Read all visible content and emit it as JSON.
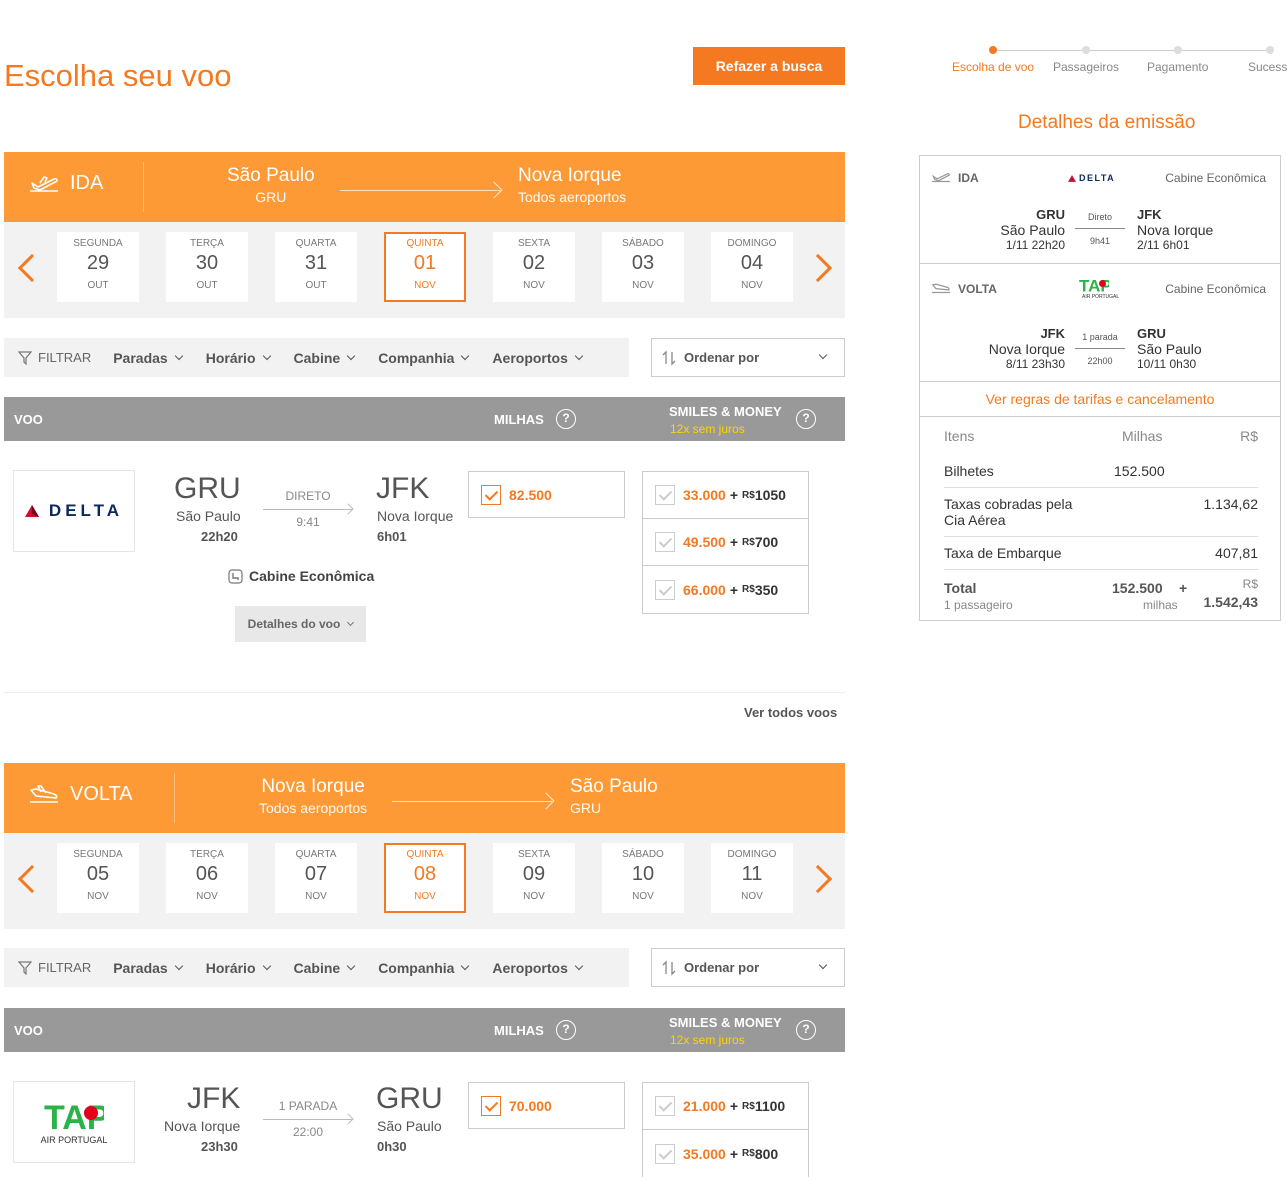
{
  "page_title": "Escolha seu voo",
  "redo_search_label": "Refazer a busca",
  "stepper": [
    "Escolha de voo",
    "Passageiros",
    "Pagamento",
    "Sucess"
  ],
  "sections": [
    {
      "direction": "IDA",
      "from_city": "São Paulo",
      "from_sub": "GRU",
      "to_city": "Nova Iorque",
      "to_sub": "Todos aeroportos",
      "dates": [
        {
          "weekday": "SEGUNDA",
          "day": "29",
          "month": "OUT"
        },
        {
          "weekday": "TERÇA",
          "day": "30",
          "month": "OUT"
        },
        {
          "weekday": "QUARTA",
          "day": "31",
          "month": "OUT"
        },
        {
          "weekday": "QUINTA",
          "day": "01",
          "month": "NOV",
          "selected": true
        },
        {
          "weekday": "SEXTA",
          "day": "02",
          "month": "NOV"
        },
        {
          "weekday": "SÁBADO",
          "day": "03",
          "month": "NOV"
        },
        {
          "weekday": "DOMINGO",
          "day": "04",
          "month": "NOV"
        }
      ],
      "flight": {
        "airline": "DELTA",
        "origin": "GRU",
        "origin_city": "São Paulo",
        "origin_time": "22h20",
        "stops": "DIRETO",
        "duration": "9:41",
        "dest": "JFK",
        "dest_city": "Nova Iorque",
        "dest_time": "6h01",
        "miles": "82.500",
        "smiles_money": [
          {
            "miles": "33.000",
            "money": "1050"
          },
          {
            "miles": "49.500",
            "money": "700"
          },
          {
            "miles": "66.000",
            "money": "350"
          }
        ]
      }
    },
    {
      "direction": "VOLTA",
      "from_city": "Nova Iorque",
      "from_sub": "Todos aeroportos",
      "to_city": "São Paulo",
      "to_sub": "GRU",
      "dates": [
        {
          "weekday": "SEGUNDA",
          "day": "05",
          "month": "NOV"
        },
        {
          "weekday": "TERÇA",
          "day": "06",
          "month": "NOV"
        },
        {
          "weekday": "QUARTA",
          "day": "07",
          "month": "NOV"
        },
        {
          "weekday": "QUINTA",
          "day": "08",
          "month": "NOV",
          "selected": true
        },
        {
          "weekday": "SEXTA",
          "day": "09",
          "month": "NOV"
        },
        {
          "weekday": "SÁBADO",
          "day": "10",
          "month": "NOV"
        },
        {
          "weekday": "DOMINGO",
          "day": "11",
          "month": "NOV"
        }
      ],
      "flight": {
        "airline": "TAP",
        "airline_sub": "AIR PORTUGAL",
        "origin": "JFK",
        "origin_city": "Nova Iorque",
        "origin_time": "23h30",
        "stops": "1 PARADA",
        "duration": "22:00",
        "dest": "GRU",
        "dest_city": "São Paulo",
        "dest_time": "0h30",
        "miles": "70.000",
        "smiles_money": [
          {
            "miles": "21.000",
            "money": "1100"
          },
          {
            "miles": "35.000",
            "money": "800"
          }
        ]
      }
    }
  ],
  "filter": {
    "label": "FILTRAR",
    "options": [
      "Paradas",
      "Horário",
      "Cabine",
      "Companhia",
      "Aeroportos"
    ],
    "sort_label": "Ordenar por"
  },
  "table_header": {
    "voo": "VOO",
    "milhas": "MILHAS",
    "smiles_money": "SMILES & MONEY",
    "installments": "12x sem juros",
    "help": "?"
  },
  "cabin_label": "Cabine Econômica",
  "details_button": "Detalhes do voo",
  "see_all": "Ver todos voos",
  "currency_symbol": "R$",
  "plus": "+",
  "panel": {
    "title": "Detalhes da emissão",
    "ida": {
      "label": "IDA",
      "airline": "DELTA",
      "cabin": "Cabine Econômica",
      "from": "GRU",
      "from_city": "São Paulo",
      "from_dt": "1/11 22h20",
      "stops": "Direto",
      "duration": "9h41",
      "to": "JFK",
      "to_city": "Nova Iorque",
      "to_dt": "2/11 6h01"
    },
    "volta": {
      "label": "VOLTA",
      "airline": "TAP",
      "airline_sub": "AIR PORTUGAL",
      "cabin": "Cabine Econômica",
      "from": "JFK",
      "from_city": "Nova Iorque",
      "from_dt": "8/11 23h30",
      "stops": "1 parada",
      "duration": "22h00",
      "to": "GRU",
      "to_city": "São Paulo",
      "to_dt": "10/11 0h30"
    },
    "rules_link": "Ver regras de tarifas e cancelamento",
    "cols": {
      "items": "Itens",
      "miles": "Milhas",
      "money": "R$"
    },
    "rows": [
      {
        "label": "Bilhetes",
        "miles": "152.500",
        "money": ""
      },
      {
        "label": "Taxas cobradas pela Cia Aérea",
        "miles": "",
        "money": "1.134,62"
      },
      {
        "label": "Taxa de Embarque",
        "miles": "",
        "money": "407,81"
      }
    ],
    "total": {
      "label": "Total",
      "passengers": "1 passageiro",
      "miles": "152.500",
      "miles_unit": "milhas",
      "plus": "+",
      "currency": "R$",
      "money": "1.542,43"
    }
  },
  "colors": {
    "accent": "#f47920",
    "header_orange": "#fd9a35",
    "table_header": "#999999",
    "installments": "#ffd400"
  }
}
